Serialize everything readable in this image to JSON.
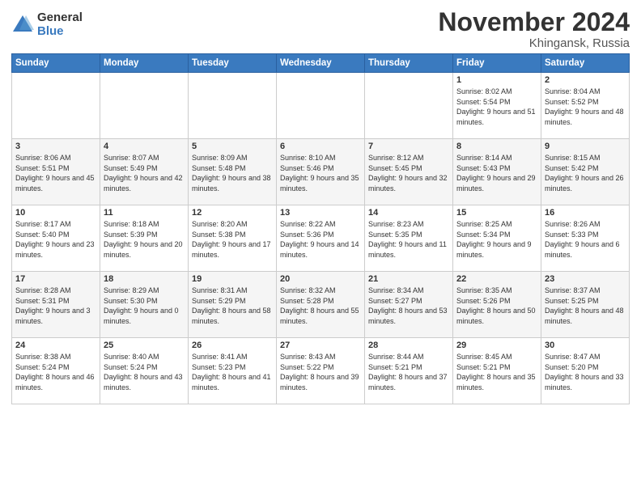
{
  "logo": {
    "general": "General",
    "blue": "Blue"
  },
  "title": "November 2024",
  "location": "Khingansk, Russia",
  "days_of_week": [
    "Sunday",
    "Monday",
    "Tuesday",
    "Wednesday",
    "Thursday",
    "Friday",
    "Saturday"
  ],
  "weeks": [
    [
      {
        "day": "",
        "info": ""
      },
      {
        "day": "",
        "info": ""
      },
      {
        "day": "",
        "info": ""
      },
      {
        "day": "",
        "info": ""
      },
      {
        "day": "",
        "info": ""
      },
      {
        "day": "1",
        "info": "Sunrise: 8:02 AM\nSunset: 5:54 PM\nDaylight: 9 hours and 51 minutes."
      },
      {
        "day": "2",
        "info": "Sunrise: 8:04 AM\nSunset: 5:52 PM\nDaylight: 9 hours and 48 minutes."
      }
    ],
    [
      {
        "day": "3",
        "info": "Sunrise: 8:06 AM\nSunset: 5:51 PM\nDaylight: 9 hours and 45 minutes."
      },
      {
        "day": "4",
        "info": "Sunrise: 8:07 AM\nSunset: 5:49 PM\nDaylight: 9 hours and 42 minutes."
      },
      {
        "day": "5",
        "info": "Sunrise: 8:09 AM\nSunset: 5:48 PM\nDaylight: 9 hours and 38 minutes."
      },
      {
        "day": "6",
        "info": "Sunrise: 8:10 AM\nSunset: 5:46 PM\nDaylight: 9 hours and 35 minutes."
      },
      {
        "day": "7",
        "info": "Sunrise: 8:12 AM\nSunset: 5:45 PM\nDaylight: 9 hours and 32 minutes."
      },
      {
        "day": "8",
        "info": "Sunrise: 8:14 AM\nSunset: 5:43 PM\nDaylight: 9 hours and 29 minutes."
      },
      {
        "day": "9",
        "info": "Sunrise: 8:15 AM\nSunset: 5:42 PM\nDaylight: 9 hours and 26 minutes."
      }
    ],
    [
      {
        "day": "10",
        "info": "Sunrise: 8:17 AM\nSunset: 5:40 PM\nDaylight: 9 hours and 23 minutes."
      },
      {
        "day": "11",
        "info": "Sunrise: 8:18 AM\nSunset: 5:39 PM\nDaylight: 9 hours and 20 minutes."
      },
      {
        "day": "12",
        "info": "Sunrise: 8:20 AM\nSunset: 5:38 PM\nDaylight: 9 hours and 17 minutes."
      },
      {
        "day": "13",
        "info": "Sunrise: 8:22 AM\nSunset: 5:36 PM\nDaylight: 9 hours and 14 minutes."
      },
      {
        "day": "14",
        "info": "Sunrise: 8:23 AM\nSunset: 5:35 PM\nDaylight: 9 hours and 11 minutes."
      },
      {
        "day": "15",
        "info": "Sunrise: 8:25 AM\nSunset: 5:34 PM\nDaylight: 9 hours and 9 minutes."
      },
      {
        "day": "16",
        "info": "Sunrise: 8:26 AM\nSunset: 5:33 PM\nDaylight: 9 hours and 6 minutes."
      }
    ],
    [
      {
        "day": "17",
        "info": "Sunrise: 8:28 AM\nSunset: 5:31 PM\nDaylight: 9 hours and 3 minutes."
      },
      {
        "day": "18",
        "info": "Sunrise: 8:29 AM\nSunset: 5:30 PM\nDaylight: 9 hours and 0 minutes."
      },
      {
        "day": "19",
        "info": "Sunrise: 8:31 AM\nSunset: 5:29 PM\nDaylight: 8 hours and 58 minutes."
      },
      {
        "day": "20",
        "info": "Sunrise: 8:32 AM\nSunset: 5:28 PM\nDaylight: 8 hours and 55 minutes."
      },
      {
        "day": "21",
        "info": "Sunrise: 8:34 AM\nSunset: 5:27 PM\nDaylight: 8 hours and 53 minutes."
      },
      {
        "day": "22",
        "info": "Sunrise: 8:35 AM\nSunset: 5:26 PM\nDaylight: 8 hours and 50 minutes."
      },
      {
        "day": "23",
        "info": "Sunrise: 8:37 AM\nSunset: 5:25 PM\nDaylight: 8 hours and 48 minutes."
      }
    ],
    [
      {
        "day": "24",
        "info": "Sunrise: 8:38 AM\nSunset: 5:24 PM\nDaylight: 8 hours and 46 minutes."
      },
      {
        "day": "25",
        "info": "Sunrise: 8:40 AM\nSunset: 5:24 PM\nDaylight: 8 hours and 43 minutes."
      },
      {
        "day": "26",
        "info": "Sunrise: 8:41 AM\nSunset: 5:23 PM\nDaylight: 8 hours and 41 minutes."
      },
      {
        "day": "27",
        "info": "Sunrise: 8:43 AM\nSunset: 5:22 PM\nDaylight: 8 hours and 39 minutes."
      },
      {
        "day": "28",
        "info": "Sunrise: 8:44 AM\nSunset: 5:21 PM\nDaylight: 8 hours and 37 minutes."
      },
      {
        "day": "29",
        "info": "Sunrise: 8:45 AM\nSunset: 5:21 PM\nDaylight: 8 hours and 35 minutes."
      },
      {
        "day": "30",
        "info": "Sunrise: 8:47 AM\nSunset: 5:20 PM\nDaylight: 8 hours and 33 minutes."
      }
    ]
  ]
}
